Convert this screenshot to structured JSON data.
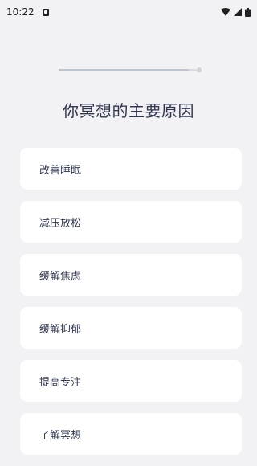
{
  "status_bar": {
    "time": "10:22",
    "icons": [
      "notification-icon",
      "wifi-icon",
      "signal-icon",
      "battery-icon"
    ]
  },
  "progress": {
    "fraction": 0.94
  },
  "page_title": "你冥想的主要原因",
  "options": [
    {
      "label": "改善睡眠"
    },
    {
      "label": "减压放松"
    },
    {
      "label": "缓解焦虑"
    },
    {
      "label": "缓解抑郁"
    },
    {
      "label": "提高专注"
    },
    {
      "label": "了解冥想"
    }
  ]
}
